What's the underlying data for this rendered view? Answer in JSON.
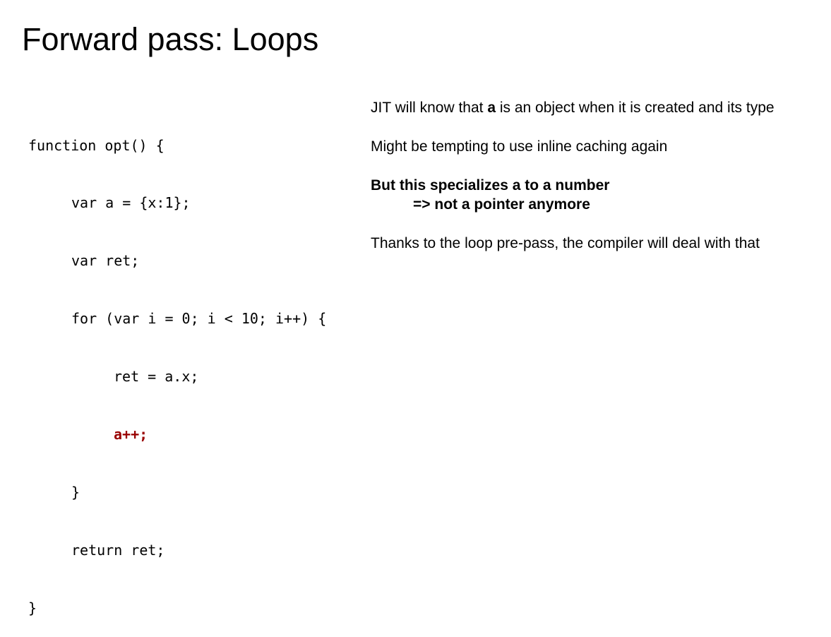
{
  "slide": {
    "title": "Forward pass: Loops"
  },
  "code": {
    "lines": [
      "function opt() {",
      "var a = {x:1};",
      "var ret;",
      "for (var i = 0; i < 10; i++) {",
      "ret = a.x;",
      "a++;",
      "}",
      "return ret;",
      "}"
    ],
    "highlight_color": "#990000"
  },
  "notes": {
    "jit_part1": "JIT will know that ",
    "jit_var": "a",
    "jit_part2": " is an object when it is created and its type",
    "tempting": "Might be tempting to use inline caching again",
    "specializes": "But this specializes a to a number",
    "pointer": "=> not a pointer anymore",
    "thanks": "Thanks to the loop pre-pass, the compiler will deal with that"
  }
}
